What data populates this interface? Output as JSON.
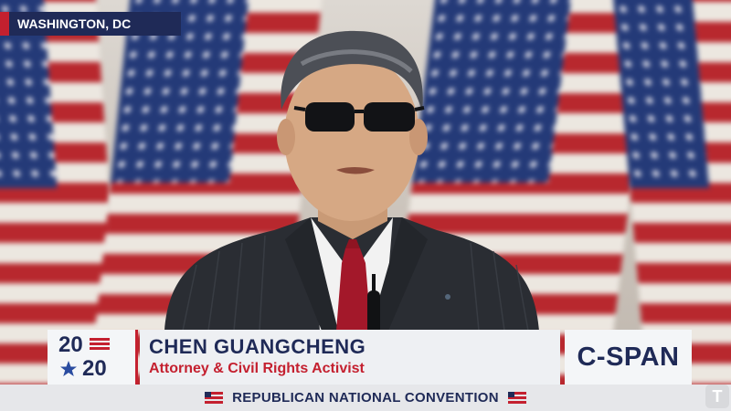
{
  "location": "WASHINGTON, DC",
  "logo_year_top": "20",
  "logo_year_bottom": "20",
  "speaker": {
    "name": "CHEN GUANGCHENG",
    "title": "Attorney & Civil Rights Activist"
  },
  "network": "C-SPAN",
  "event": "REPUBLICAN NATIONAL CONVENTION",
  "watermark": "T",
  "colors": {
    "navy": "#1f2a57",
    "red": "#c4202f",
    "panel": "#eef0f3"
  }
}
